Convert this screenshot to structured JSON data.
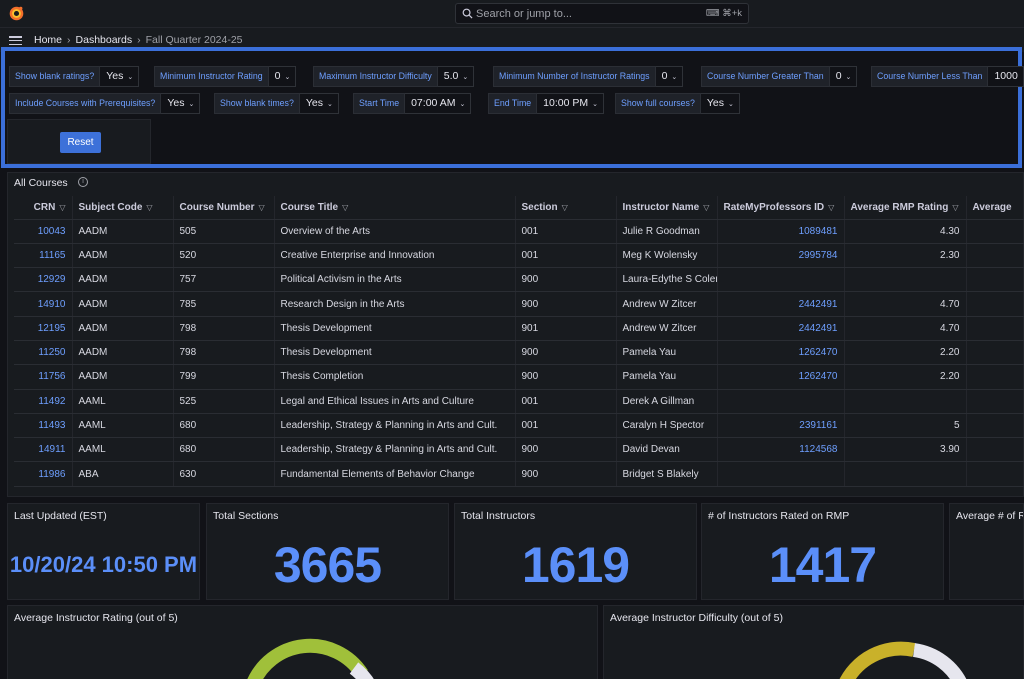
{
  "search": {
    "placeholder": "Search or jump to...",
    "shortcut": "⌨ ⌘+k"
  },
  "breadcrumb": {
    "home": "Home",
    "dashboards": "Dashboards",
    "current": "Fall Quarter 2024-25"
  },
  "variables": [
    {
      "label": "Show blank ratings?",
      "value": "Yes"
    },
    {
      "label": "Minimum Instructor Rating",
      "value": "0"
    },
    {
      "label": "Maximum Instructor Difficulty",
      "value": "5.0"
    },
    {
      "label": "Minimum Number of Instructor Ratings",
      "value": "0"
    },
    {
      "label": "Course Number Greater Than",
      "value": "0"
    },
    {
      "label": "Course Number Less Than",
      "value": "1000"
    },
    {
      "label": "Include Courses with Prerequisites?",
      "value": "Yes"
    },
    {
      "label": "Show blank times?",
      "value": "Yes"
    },
    {
      "label": "Start Time",
      "value": "07:00 AM"
    },
    {
      "label": "End Time",
      "value": "10:00 PM"
    },
    {
      "label": "Show full courses?",
      "value": "Yes"
    }
  ],
  "reset_label": "Reset",
  "table": {
    "title": "All Courses",
    "columns": [
      "CRN",
      "Subject Code",
      "Course Number",
      "Course Title",
      "Section",
      "Instructor Name",
      "RateMyProfessors ID",
      "Average RMP Rating",
      "Average"
    ],
    "rows": [
      [
        "10043",
        "AADM",
        "505",
        "Overview of the Arts",
        "001",
        "Julie R Goodman",
        "1089481",
        "4.30",
        ""
      ],
      [
        "11165",
        "AADM",
        "520",
        "Creative Enterprise and Innovation",
        "001",
        "Meg K Wolensky",
        "2995784",
        "2.30",
        ""
      ],
      [
        "12929",
        "AADM",
        "757",
        "Political Activism in the Arts",
        "900",
        "Laura-Edythe S Coleman",
        "",
        "",
        ""
      ],
      [
        "14910",
        "AADM",
        "785",
        "Research Design in the Arts",
        "900",
        "Andrew W Zitcer",
        "2442491",
        "4.70",
        ""
      ],
      [
        "12195",
        "AADM",
        "798",
        "Thesis Development",
        "901",
        "Andrew W Zitcer",
        "2442491",
        "4.70",
        ""
      ],
      [
        "11250",
        "AADM",
        "798",
        "Thesis Development",
        "900",
        "Pamela Yau",
        "1262470",
        "2.20",
        ""
      ],
      [
        "11756",
        "AADM",
        "799",
        "Thesis Completion",
        "900",
        "Pamela Yau",
        "1262470",
        "2.20",
        ""
      ],
      [
        "11492",
        "AAML",
        "525",
        "Legal and Ethical Issues in Arts and Culture",
        "001",
        "Derek A Gillman",
        "",
        "",
        ""
      ],
      [
        "11493",
        "AAML",
        "680",
        "Leadership, Strategy & Planning in Arts and Cult.",
        "001",
        "Caralyn H Spector",
        "2391161",
        "5",
        ""
      ],
      [
        "14911",
        "AAML",
        "680",
        "Leadership, Strategy & Planning in Arts and Cult.",
        "900",
        "David Devan",
        "1124568",
        "3.90",
        ""
      ],
      [
        "11986",
        "ABA",
        "630",
        "Fundamental Elements of Behavior Change",
        "900",
        "Bridget S Blakely",
        "",
        "",
        ""
      ]
    ]
  },
  "stats": {
    "last_updated_title": "Last Updated (EST)",
    "last_updated_value": "10/20/24 10:50 PM",
    "total_sections_title": "Total Sections",
    "total_sections_value": "3665",
    "total_instructors_title": "Total Instructors",
    "total_instructors_value": "1619",
    "rated_title": "# of Instructors Rated on RMP",
    "rated_value": "1417",
    "avg_title": "Average # of R"
  },
  "gauges": {
    "rating_title": "Average Instructor Rating (out of 5)",
    "difficulty_title": "Average Instructor Difficulty (out of 5)"
  },
  "colors": {
    "accent": "#3b6fd9",
    "value_blue": "#5b8ff9",
    "gauge_green": "#a0c03a",
    "gauge_yellow": "#c9b12a"
  }
}
